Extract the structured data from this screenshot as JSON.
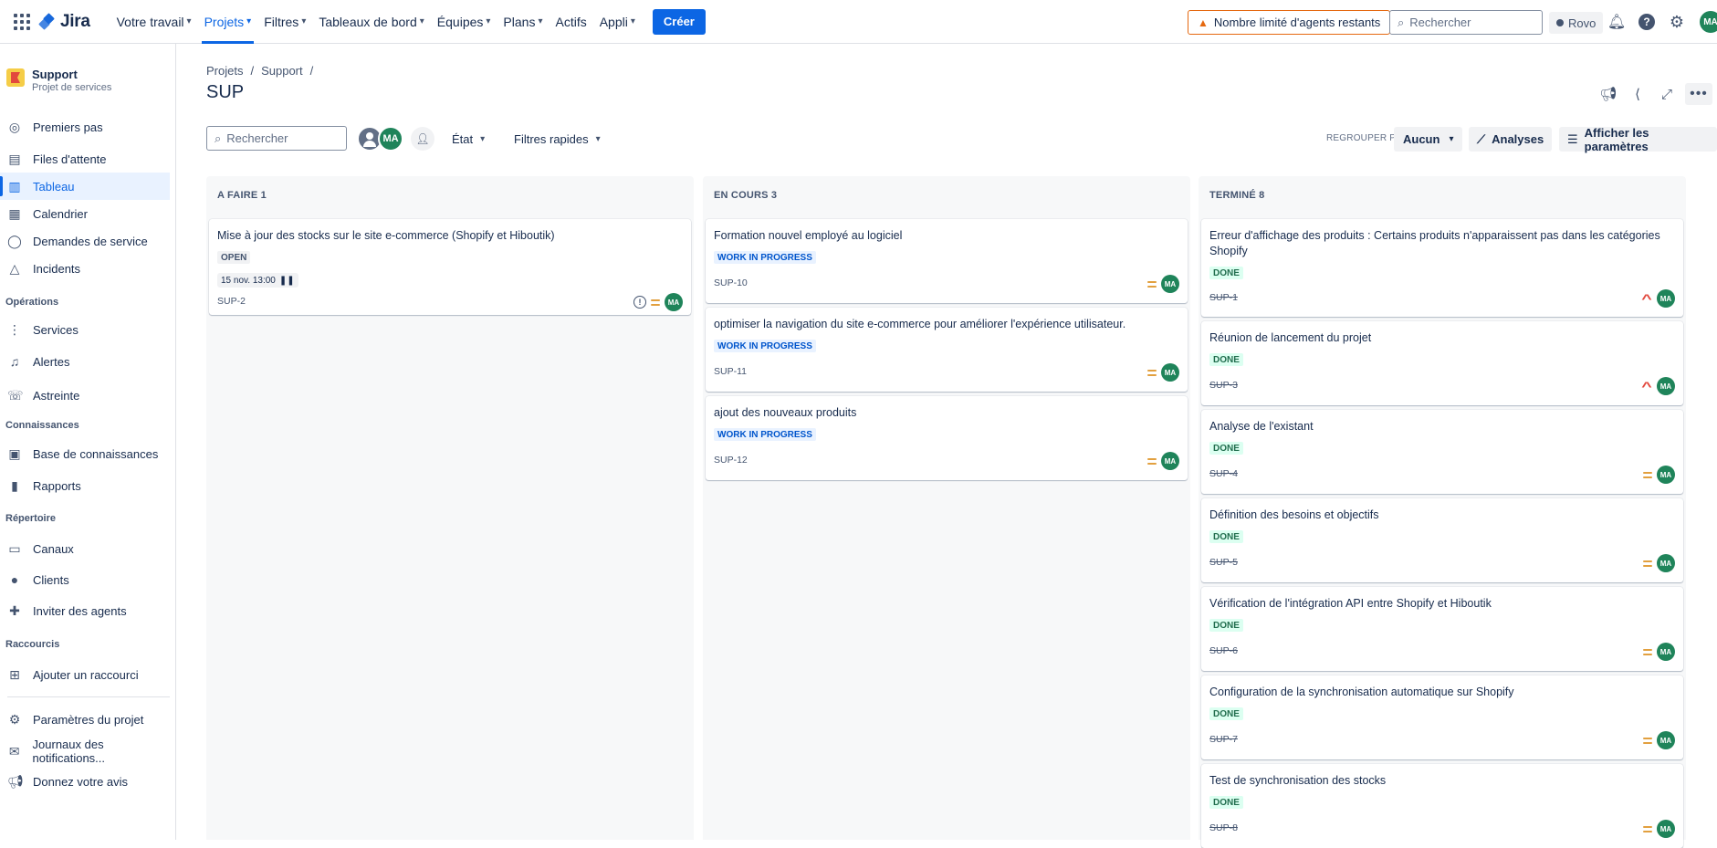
{
  "topnav": {
    "logo": "Jira",
    "items": [
      {
        "label": "Votre travail"
      },
      {
        "label": "Projets"
      },
      {
        "label": "Filtres"
      },
      {
        "label": "Tableaux de bord"
      },
      {
        "label": "Équipes"
      },
      {
        "label": "Plans"
      },
      {
        "label": "Actifs"
      },
      {
        "label": "Appli"
      }
    ],
    "create_label": "Créer",
    "warning_label": "Nombre limité d'agents restants",
    "search_placeholder": "Rechercher",
    "rovo_label": "Rovo",
    "avatar_initials": "MA",
    "accent_color": "#0c66e4"
  },
  "sidebar": {
    "project_name": "Support",
    "project_type": "Projet de services",
    "items": [
      {
        "label": "Premiers pas",
        "icon": "compass-icon"
      },
      {
        "label": "Files d'attente",
        "icon": "queue-icon"
      },
      {
        "label": "Tableau",
        "icon": "board-icon"
      },
      {
        "label": "Calendrier",
        "icon": "calendar-icon"
      },
      {
        "label": "Demandes de service",
        "icon": "chat-icon"
      },
      {
        "label": "Incidents",
        "icon": "warning-icon"
      }
    ],
    "sections": {
      "operations": "Opérations",
      "connaissances": "Connaissances",
      "repertoire": "Répertoire",
      "raccourcis": "Raccourcis"
    },
    "ops_items": [
      {
        "label": "Services"
      },
      {
        "label": "Alertes"
      },
      {
        "label": "Astreinte"
      }
    ],
    "kb_items": [
      {
        "label": "Base de connaissances"
      },
      {
        "label": "Rapports"
      }
    ],
    "dir_items": [
      {
        "label": "Canaux"
      },
      {
        "label": "Clients"
      },
      {
        "label": "Inviter des agents"
      }
    ],
    "shortcut_items": [
      {
        "label": "Ajouter un raccourci"
      }
    ],
    "bottom_items": [
      {
        "label": "Paramètres du projet"
      },
      {
        "label": "Journaux des notifications..."
      },
      {
        "label": "Donnez votre avis"
      }
    ]
  },
  "main": {
    "breadcrumb": [
      "Projets",
      "Support"
    ],
    "title": "SUP",
    "search_placeholder": "Rechercher",
    "avatar_initials": "MA",
    "filter_state": "État",
    "filter_quick": "Filtres rapides",
    "group_by_label": "REGROUPER PAR",
    "group_by_value": "Aucun",
    "analyses_label": "Analyses",
    "settings_label": "Afficher les paramètres"
  },
  "board": {
    "columns": [
      {
        "title": "A FAIRE 1",
        "cards": [
          {
            "title": "Mise à jour des stocks sur le site e-commerce (Shopify et Hiboutik)",
            "status": "OPEN",
            "date": "15 nov. 13:00",
            "key": "SUP-2",
            "avatar": "MA"
          }
        ]
      },
      {
        "title": "EN COURS 3",
        "cards": [
          {
            "title": "Formation nouvel employé au logiciel",
            "status": "WORK IN PROGRESS",
            "key": "SUP-10",
            "avatar": "MA"
          },
          {
            "title": "optimiser la navigation du site e-commerce pour améliorer l'expérience utilisateur.",
            "status": "WORK IN PROGRESS",
            "key": "SUP-11",
            "avatar": "MA"
          },
          {
            "title": "ajout des nouveaux produits",
            "status": "WORK IN PROGRESS",
            "key": "SUP-12",
            "avatar": "MA"
          }
        ]
      },
      {
        "title": "TERMINÉ 8",
        "cards": [
          {
            "title": "Erreur d'affichage des produits : Certains produits n'apparaissent pas dans les catégories Shopify",
            "status": "DONE",
            "key": "SUP-1",
            "avatar": "MA",
            "priority": "high"
          },
          {
            "title": "Réunion de lancement du projet",
            "status": "DONE",
            "key": "SUP-3",
            "avatar": "MA",
            "priority": "high"
          },
          {
            "title": "Analyse de l'existant",
            "status": "DONE",
            "key": "SUP-4",
            "avatar": "MA",
            "priority": "medium"
          },
          {
            "title": "Définition des besoins et objectifs",
            "status": "DONE",
            "key": "SUP-5",
            "avatar": "MA",
            "priority": "medium"
          },
          {
            "title": "Vérification de l'intégration API entre Shopify et Hiboutik",
            "status": "DONE",
            "key": "SUP-6",
            "avatar": "MA",
            "priority": "medium"
          },
          {
            "title": "Configuration de la synchronisation automatique sur Shopify",
            "status": "DONE",
            "key": "SUP-7",
            "avatar": "MA",
            "priority": "medium"
          },
          {
            "title": "Test de synchronisation des stocks",
            "status": "DONE",
            "key": "SUP-8",
            "avatar": "MA",
            "priority": "medium"
          }
        ]
      }
    ]
  }
}
